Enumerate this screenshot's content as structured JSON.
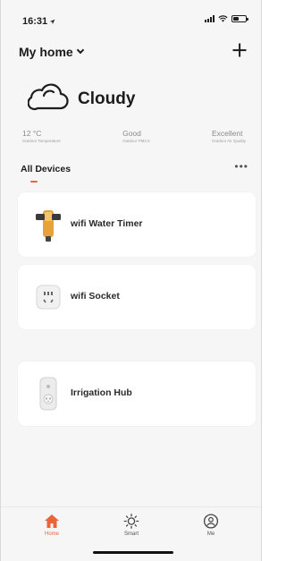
{
  "status_bar": {
    "time": "16:31",
    "location_icon": "location-arrow-icon",
    "signal_icon": "signal-icon",
    "wifi_icon": "wifi-icon",
    "battery_icon": "battery-icon"
  },
  "header": {
    "home_name": "My home",
    "chevron_icon": "chevron-down-icon",
    "add_icon": "plus-icon"
  },
  "weather": {
    "icon": "cloud-icon",
    "condition": "Cloudy",
    "stats": [
      {
        "value": "12 °C",
        "label": "Outdoor Temperature"
      },
      {
        "value": "Good",
        "label": "Outdoor PM2.5"
      },
      {
        "value": "Excellent",
        "label": "Outdoor Air Quality"
      }
    ]
  },
  "devices": {
    "title": "All Devices",
    "more": "•••",
    "items": [
      {
        "name": "wifi Water Timer",
        "icon": "water-timer-icon"
      },
      {
        "name": "wifi Socket",
        "icon": "socket-icon"
      },
      {
        "name": "Irrigation Hub",
        "icon": "hub-icon"
      }
    ]
  },
  "tabs": [
    {
      "label": "Home",
      "icon": "home-icon",
      "active": true
    },
    {
      "label": "Smart",
      "icon": "sun-icon",
      "active": false
    },
    {
      "label": "Me",
      "icon": "user-icon",
      "active": false
    }
  ],
  "colors": {
    "accent": "#e8663a",
    "background": "#f6f6f6",
    "card": "#ffffff"
  }
}
